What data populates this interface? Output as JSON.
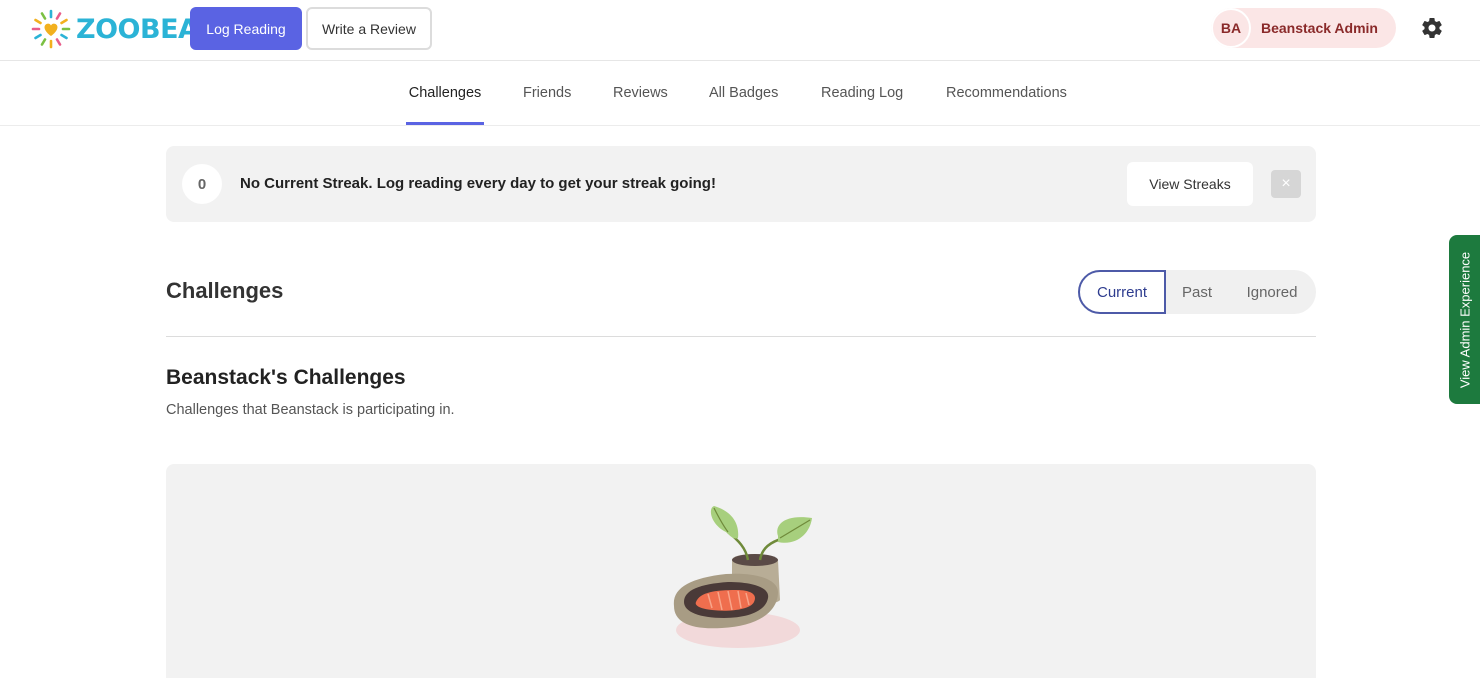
{
  "header": {
    "logo_text": "ZOOBEAN",
    "log_reading_label": "Log Reading",
    "write_review_label": "Write a Review",
    "user_initials": "BA",
    "user_name": "Beanstack Admin"
  },
  "nav": {
    "tabs": [
      {
        "label": "Challenges",
        "active": true
      },
      {
        "label": "Friends",
        "active": false
      },
      {
        "label": "Reviews",
        "active": false
      },
      {
        "label": "All Badges",
        "active": false
      },
      {
        "label": "Reading Log",
        "active": false
      },
      {
        "label": "Recommendations",
        "active": false
      }
    ]
  },
  "streak": {
    "count": "0",
    "message": "No Current Streak. Log reading every day to get your streak going!",
    "button_label": "View Streaks",
    "close_icon": "×"
  },
  "challenges": {
    "title": "Challenges",
    "filters": [
      "Current",
      "Past",
      "Ignored"
    ],
    "active_filter": "Current",
    "group_title": "Beanstack's Challenges",
    "group_description": "Challenges that Beanstack is participating in."
  },
  "side_tab": {
    "label": "View Admin Experience"
  },
  "colors": {
    "primary": "#5a63e3",
    "brand_text": "#2bb3d6",
    "user_text": "#8a2a2a",
    "admin_tab": "#1d7a3e"
  }
}
